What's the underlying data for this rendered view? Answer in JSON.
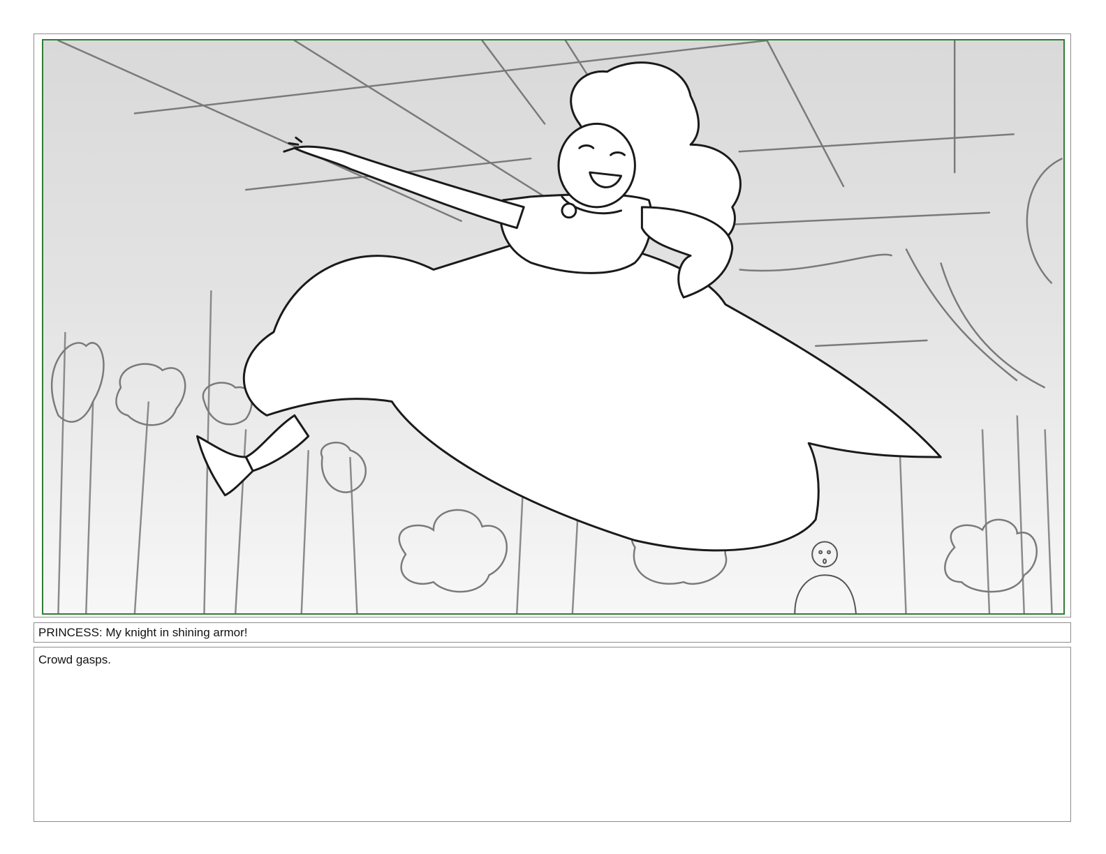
{
  "storyboard": {
    "dialogue": "PRINCESS: My knight in shining armor!",
    "action_notes": "Crowd gasps."
  },
  "colors": {
    "safe_frame": "#2e7d32",
    "border": "#8c8c8c",
    "sketch_line": "#1a1a1a",
    "background_line": "#7a7a7a"
  }
}
